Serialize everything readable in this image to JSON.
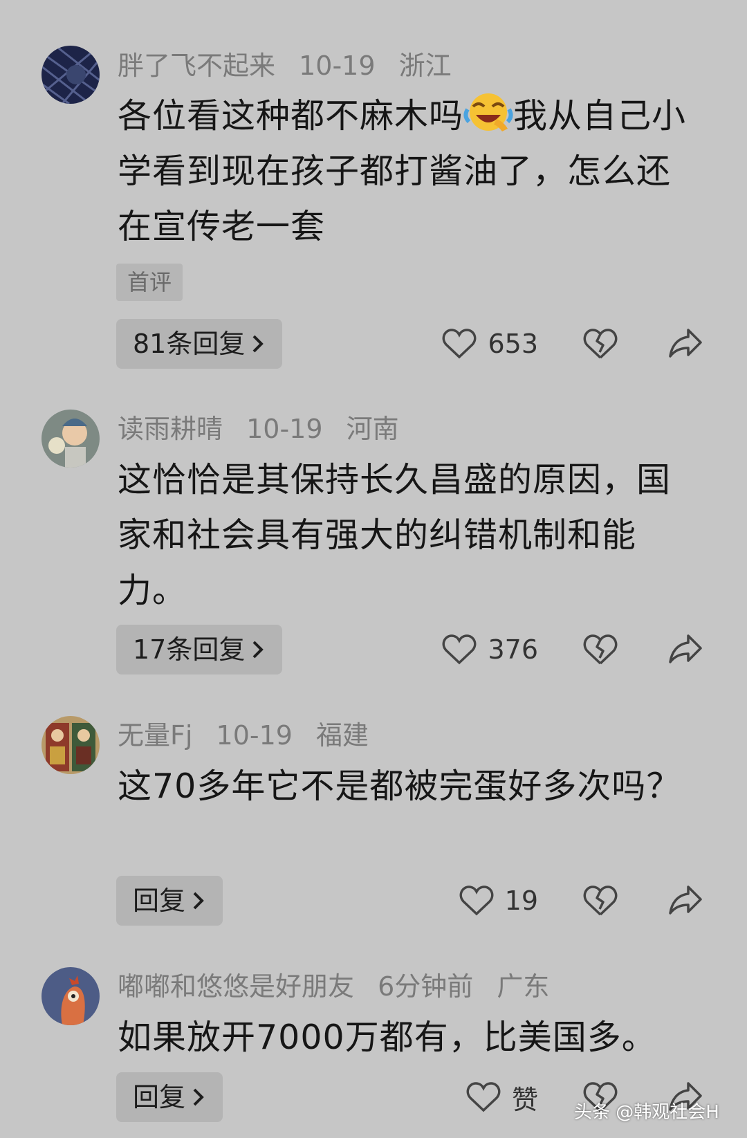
{
  "comments": [
    {
      "username": "胖了飞不起来",
      "date": "10-19",
      "location": "浙江",
      "text_before_emoji": "各位看这种都不麻木吗",
      "emoji": "laughing-crying-emoji",
      "text_after_emoji": "我从自己小学看到现在孩子都打酱油了，怎么还在宣传老一套",
      "badge": "首评",
      "reply_label": "81条回复",
      "likes": "653"
    },
    {
      "username": "读雨耕晴",
      "date": "10-19",
      "location": "河南",
      "text": "这恰恰是其保持长久昌盛的原因，国家和社会具有强大的纠错机制和能力。",
      "reply_label": "17条回复",
      "likes": "376"
    },
    {
      "username": "无量Fj",
      "date": "10-19",
      "location": "福建",
      "text": "这70多年它不是都被完蛋好多次吗？",
      "reply_label": "回复",
      "likes": "19"
    },
    {
      "username": "嘟嘟和悠悠是好朋友",
      "date": "6分钟前",
      "location": "广东",
      "text": "如果放开7000万都有，比美国多。",
      "reply_label": "回复",
      "likes": "赞"
    }
  ],
  "icons": {
    "like": "heart-outline-icon",
    "dislike": "broken-heart-icon",
    "share": "share-arrow-icon",
    "reply_chevron": "chevron-right-icon"
  },
  "watermark": "头条 @韩观社会H",
  "colors": {
    "background": "#c6c6c6",
    "username": "#7a7a7a",
    "body_text": "#161616",
    "button_bg": "#b4b4b4"
  }
}
